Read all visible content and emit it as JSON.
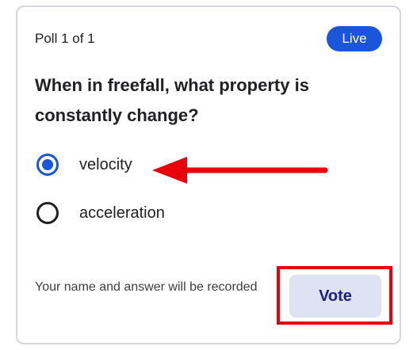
{
  "poll": {
    "count_label": "Poll 1 of 1",
    "status_badge": "Live",
    "question": "When in freefall, what property is constantly change?",
    "options": [
      {
        "label": "velocity",
        "selected": true
      },
      {
        "label": "acceleration",
        "selected": false
      }
    ],
    "footer_note": "Your name and answer will be recorded",
    "vote_label": "Vote"
  },
  "annotations": {
    "arrow_target": "velocity",
    "highlight_target": "Vote",
    "annotation_color": "#e8000b"
  },
  "colors": {
    "accent": "#1a56db",
    "vote_button_bg": "#dde3f3",
    "vote_button_text": "#1a237e",
    "border": "#d3d6da"
  }
}
